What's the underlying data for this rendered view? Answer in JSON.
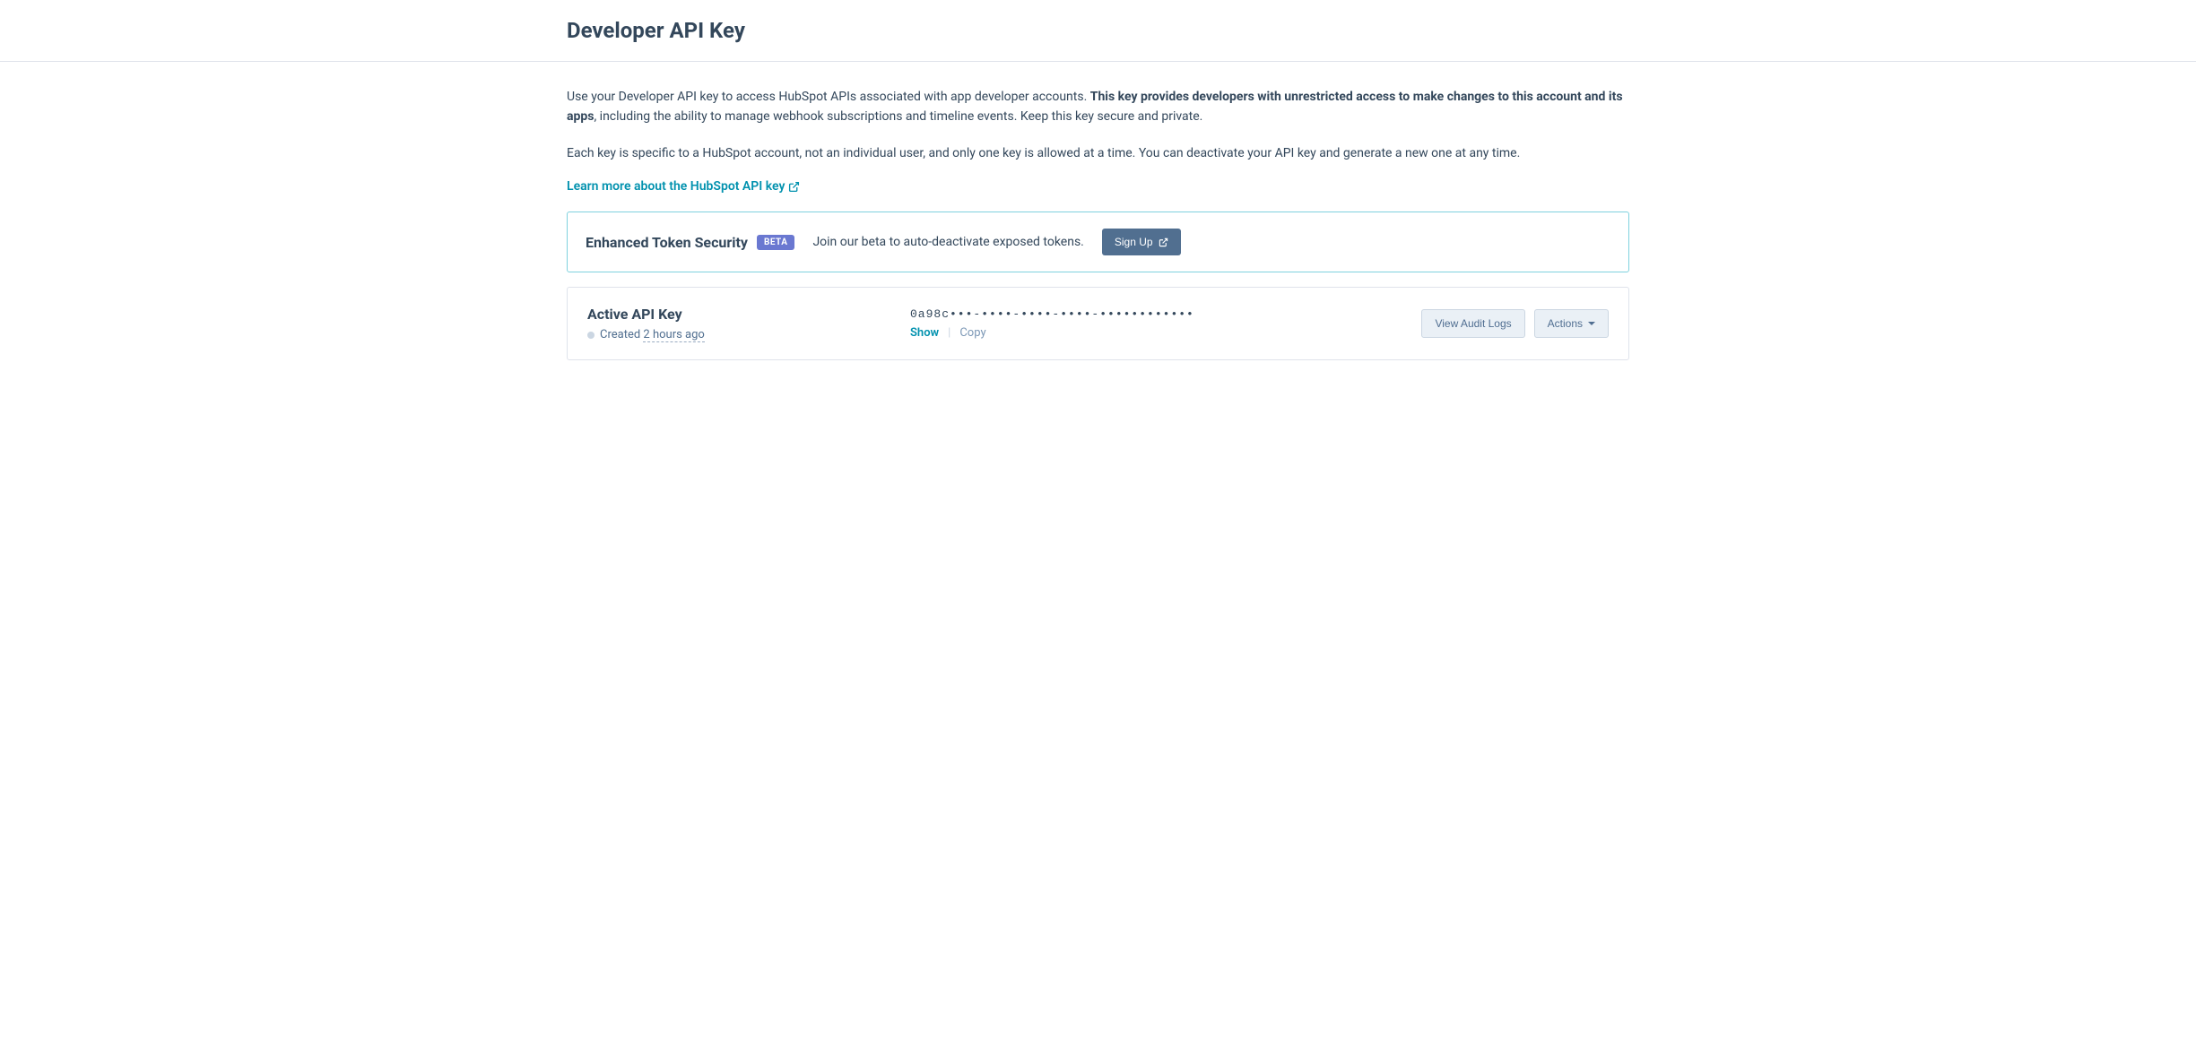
{
  "page": {
    "title": "Developer API Key"
  },
  "description": {
    "intro": "Use your Developer API key to access HubSpot APIs associated with app developer accounts. ",
    "bold_part": "This key provides developers with unrestricted access to make changes to this account and its apps",
    "outro": ", including the ability to manage webhook subscriptions and timeline events. Keep this key secure and private.",
    "paragraph2": "Each key is specific to a HubSpot account, not an individual user, and only one key is allowed at a time. You can deactivate your API key and generate a new one at any time.",
    "learn_more": "Learn more about the HubSpot API key"
  },
  "beta_banner": {
    "title": "Enhanced Token Security",
    "badge": "BETA",
    "description": "Join our beta to auto-deactivate exposed tokens.",
    "signup_label": "Sign Up"
  },
  "api_key_card": {
    "title": "Active API Key",
    "created_prefix": "Created ",
    "created_time": "2 hours ago",
    "masked_key": "0a98c•••-••••-••••-••••-••••••••••••",
    "show_label": "Show",
    "copy_label": "Copy",
    "audit_logs_label": "View Audit Logs",
    "actions_label": "Actions"
  }
}
